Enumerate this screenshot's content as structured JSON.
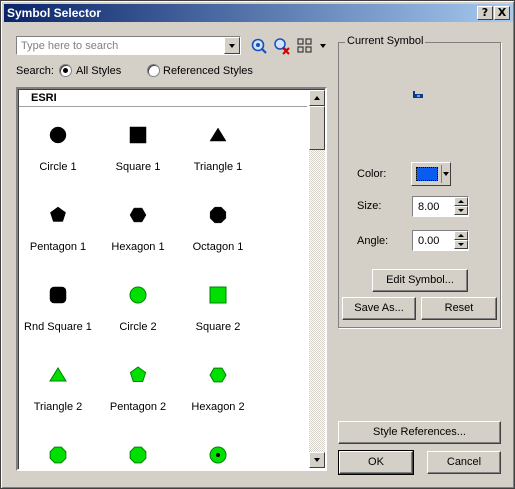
{
  "window": {
    "title": "Symbol Selector",
    "help_button": "?",
    "close_button": "X"
  },
  "search": {
    "placeholder": "Type here to search",
    "label": "Search:",
    "options": [
      "All Styles",
      "Referenced Styles"
    ],
    "selected": "All Styles"
  },
  "symbol_list": {
    "style_name": "ESRI",
    "items": [
      {
        "label": "Circle 1",
        "shape": "circle",
        "color": "#000000"
      },
      {
        "label": "Square 1",
        "shape": "square",
        "color": "#000000"
      },
      {
        "label": "Triangle 1",
        "shape": "triangle",
        "color": "#000000"
      },
      {
        "label": "Pentagon 1",
        "shape": "pentagon",
        "color": "#000000"
      },
      {
        "label": "Hexagon 1",
        "shape": "hexagon",
        "color": "#000000"
      },
      {
        "label": "Octagon 1",
        "shape": "octagon",
        "color": "#000000"
      },
      {
        "label": "Rnd Square 1",
        "shape": "rounded-square",
        "color": "#000000"
      },
      {
        "label": "Circle 2",
        "shape": "circle",
        "color": "#00e000"
      },
      {
        "label": "Square 2",
        "shape": "square",
        "color": "#00e000"
      },
      {
        "label": "Triangle 2",
        "shape": "triangle",
        "color": "#00e000"
      },
      {
        "label": "Pentagon 2",
        "shape": "pentagon",
        "color": "#00e000"
      },
      {
        "label": "Hexagon 2",
        "shape": "hexagon",
        "color": "#00e000"
      },
      {
        "label": "",
        "shape": "octagon",
        "color": "#00e000"
      },
      {
        "label": "",
        "shape": "octagon",
        "color": "#00e000"
      },
      {
        "label": "",
        "shape": "circle-dot",
        "color": "#00e000"
      }
    ]
  },
  "current_symbol": {
    "group_title": "Current Symbol",
    "color_label": "Color:",
    "color_value": "#0a5cf0",
    "size_label": "Size:",
    "size_value": "8.00",
    "angle_label": "Angle:",
    "angle_value": "0.00",
    "edit_button": "Edit Symbol...",
    "save_as_button": "Save As...",
    "reset_button": "Reset"
  },
  "footer": {
    "style_references_button": "Style References...",
    "ok_button": "OK",
    "cancel_button": "Cancel"
  }
}
